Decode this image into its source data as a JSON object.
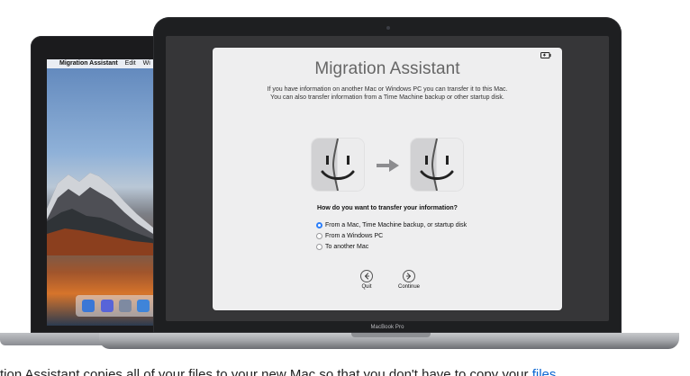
{
  "back_menu": {
    "apple_symbol": "",
    "app_name": "Migration Assistant",
    "edit": "Edit",
    "window": "Wi"
  },
  "window": {
    "title": "Migration Assistant",
    "info_line_1": "If you have information on another Mac or Windows PC you can transfer it to this Mac.",
    "info_line_2": "You can also transfer information from a Time Machine backup or other startup disk.",
    "question": "How do you want to transfer your information?",
    "options": [
      {
        "label": "From a Mac, Time Machine backup, or startup disk",
        "selected": true
      },
      {
        "label": "From a Windows PC",
        "selected": false
      },
      {
        "label": "To another Mac",
        "selected": false
      }
    ],
    "quit_label": "Quit",
    "continue_label": "Continue",
    "status_icon": "battery-icon"
  },
  "laptop_label": "MacBook Pro",
  "caption": {
    "prefix": "tion Assistant copies all of your files to your new Mac so that you don't have to copy your ",
    "link": "files"
  },
  "colors": {
    "accent": "#2d7ff9",
    "screen_bg": "#363638",
    "window_bg": "#eeeeef",
    "title_gray": "#666666",
    "link_blue": "#0a66d2"
  }
}
